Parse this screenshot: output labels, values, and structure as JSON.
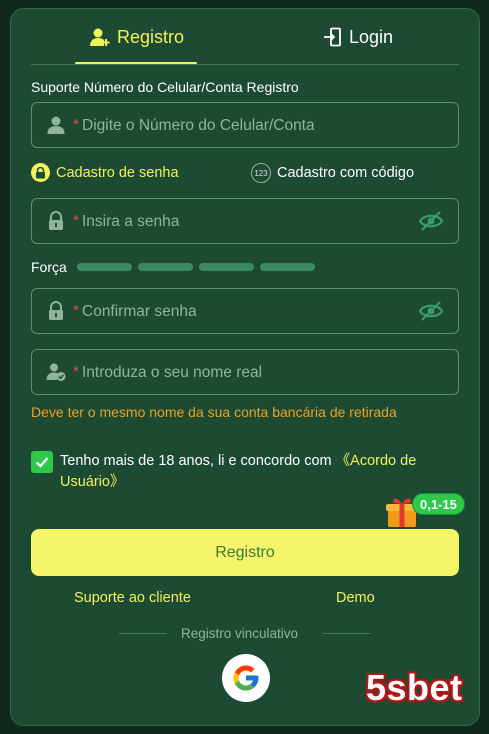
{
  "tabs": {
    "register": "Registro",
    "login": "Login"
  },
  "account": {
    "label": "Suporte Número do Celular/Conta Registro",
    "required_mark": "*",
    "placeholder": "Digite o Número do Celular/Conta"
  },
  "modes": {
    "password": "Cadastro de senha",
    "code": "Cadastro com código",
    "code_icon_text": "123"
  },
  "password": {
    "required_mark": "*",
    "placeholder": "Insira a senha"
  },
  "strength": {
    "label": "Força",
    "level": 0
  },
  "confirm": {
    "required_mark": "*",
    "placeholder": "Confirmar senha"
  },
  "realname": {
    "required_mark": "*",
    "placeholder": "Introduza o seu nome real",
    "warning": "Deve ter o mesmo nome da sua conta bancária de retirada"
  },
  "agreement": {
    "checked": true,
    "text": "Tenho mais de 18 anos, li e concordo com ",
    "link": "《Acordo de Usuário》"
  },
  "bonus": {
    "badge": "0,1-15"
  },
  "submit": {
    "label": "Registro"
  },
  "links": {
    "support": "Suporte ao cliente",
    "demo": "Demo"
  },
  "social": {
    "divider_text": "Registro vinculativo"
  },
  "brand": {
    "name": "5sbet"
  },
  "colors": {
    "accent": "#f2f25a",
    "panel": "#1d4a33",
    "warning": "#f0a020",
    "check": "#2ec84a"
  }
}
